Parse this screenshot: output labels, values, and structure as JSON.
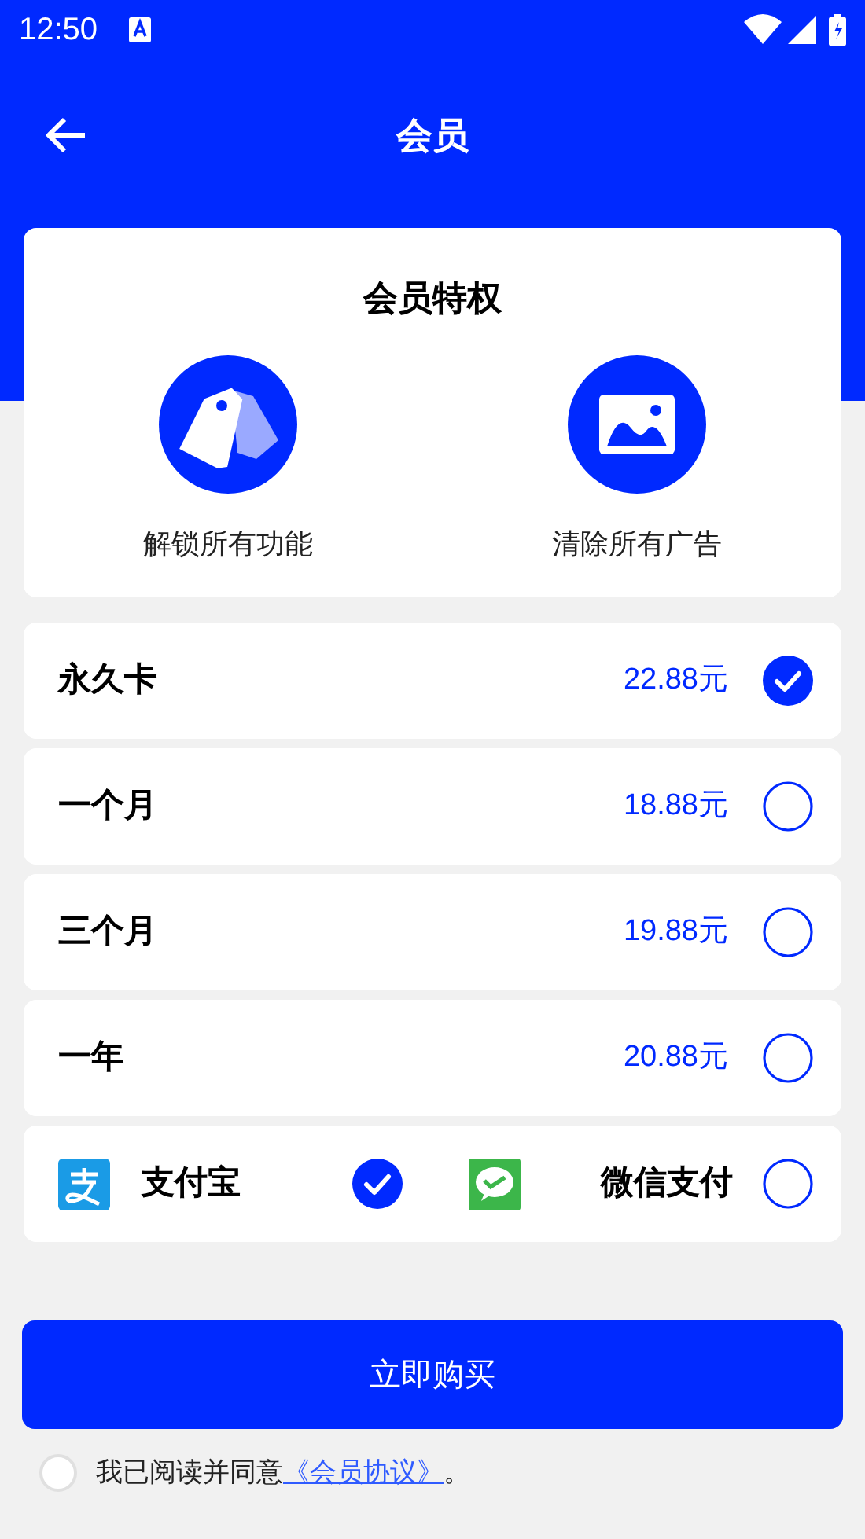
{
  "status_bar": {
    "time": "12:50"
  },
  "toolbar": {
    "title": "会员"
  },
  "privileges": {
    "title": "会员特权",
    "items": [
      {
        "kind": "tags",
        "label": "解锁所有功能"
      },
      {
        "kind": "image",
        "label": "清除所有广告"
      }
    ]
  },
  "plans": [
    {
      "name": "永久卡",
      "price": "22.88元",
      "selected": true
    },
    {
      "name": "一个月",
      "price": "18.88元",
      "selected": false
    },
    {
      "name": "三个月",
      "price": "19.88元",
      "selected": false
    },
    {
      "name": "一年",
      "price": "20.88元",
      "selected": false
    }
  ],
  "payment_methods": [
    {
      "kind": "alipay",
      "label": "支付宝",
      "selected": true
    },
    {
      "kind": "wechat",
      "label": "微信支付",
      "selected": false
    }
  ],
  "buy_button": "立即购买",
  "agreement": {
    "checked": false,
    "text": "我已阅读并同意",
    "link": "《会员协议》",
    "suffix": "。"
  }
}
